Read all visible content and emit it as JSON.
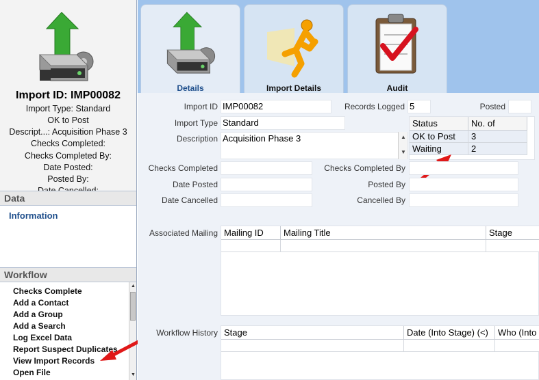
{
  "summary": {
    "title": "Import ID: IMP00082",
    "lines": [
      "Import Type: Standard",
      "OK to Post",
      "Descript...: Acquisition Phase 3",
      "Checks Completed:",
      "Checks Completed By:",
      "Date Posted:",
      "Posted By:",
      "Date Cancelled:"
    ]
  },
  "data_section": {
    "header": "Data",
    "items": [
      "Information"
    ]
  },
  "workflow_section": {
    "header": "Workflow",
    "items": [
      "Checks Complete",
      "Add a Contact",
      "Add a Group",
      "Add a Search",
      "Log Excel Data",
      "Report Suspect Duplicates",
      "View Import Records",
      "Open File"
    ]
  },
  "tabs": [
    {
      "label": "Details",
      "icon": "import-drive-icon"
    },
    {
      "label": "Import Details",
      "icon": "running-man-icon"
    },
    {
      "label": "Audit",
      "icon": "clipboard-check-icon"
    }
  ],
  "form": {
    "import_id_label": "Import ID",
    "import_id": "IMP00082",
    "records_logged_label": "Records Logged",
    "records_logged": "5",
    "posted_label": "Posted",
    "posted": "",
    "import_type_label": "Import Type",
    "import_type": "Standard",
    "description_label": "Description",
    "description": "Acquisition Phase 3",
    "checks_completed_label": "Checks Completed",
    "checks_completed": "",
    "checks_completed_by_label": "Checks Completed By",
    "checks_completed_by": "",
    "date_posted_label": "Date Posted",
    "date_posted": "",
    "posted_by_label": "Posted By",
    "posted_by": "",
    "date_cancelled_label": "Date Cancelled",
    "date_cancelled": "",
    "cancelled_by_label": "Cancelled By",
    "cancelled_by": ""
  },
  "status_table": {
    "headers": [
      "Status",
      "No. of"
    ],
    "rows": [
      [
        "OK to Post",
        "3"
      ],
      [
        "Waiting",
        "2"
      ]
    ]
  },
  "mailing_grid": {
    "label": "Associated Mailing",
    "headers": [
      "Mailing ID",
      "Mailing Title",
      "Stage"
    ]
  },
  "workflow_history": {
    "label": "Workflow History",
    "headers": [
      "Stage",
      "Date (Into Stage) (<)",
      "Who (Into ..."
    ]
  },
  "colors": {
    "tab_bar": "#9fc3ec",
    "link": "#1f4f8c",
    "annotation_arrow": "#e01818"
  }
}
